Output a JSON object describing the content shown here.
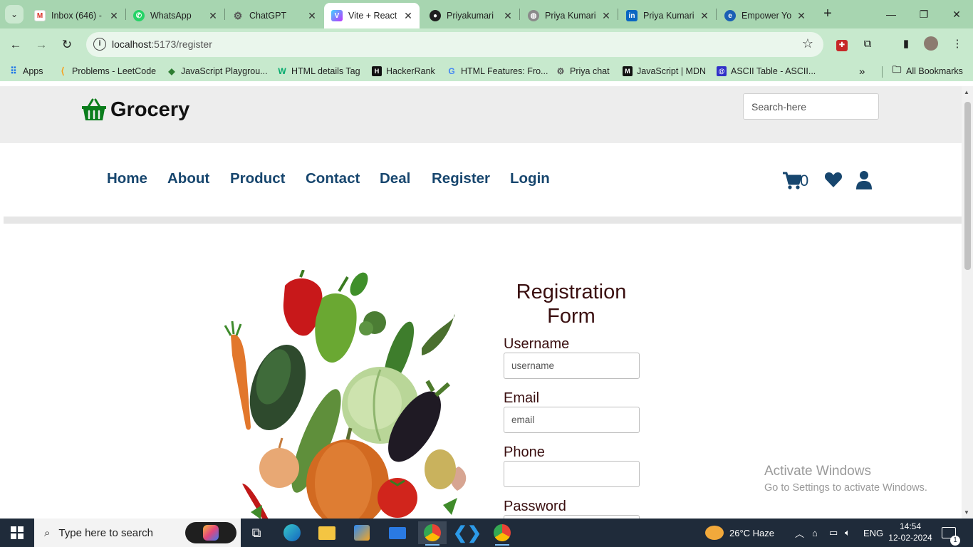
{
  "browser": {
    "tabs": [
      {
        "title": "Inbox (646) -",
        "favicon": "gmail-icon",
        "active": false
      },
      {
        "title": "WhatsApp",
        "favicon": "whatsapp-icon",
        "active": false
      },
      {
        "title": "ChatGPT",
        "favicon": "chatgpt-icon",
        "active": false
      },
      {
        "title": "Vite + React",
        "favicon": "vite-icon",
        "active": true
      },
      {
        "title": "Priyakumari",
        "favicon": "github-icon",
        "active": false
      },
      {
        "title": "Priya Kumari",
        "favicon": "globe-icon",
        "active": false
      },
      {
        "title": "Priya Kumari",
        "favicon": "linkedin-icon",
        "active": false
      },
      {
        "title": "Empower Yo",
        "favicon": "edge-icon",
        "active": false
      }
    ],
    "url_host": "localhost",
    "url_path": ":5173/register",
    "bookmarks": [
      {
        "label": "Apps",
        "icon": "apps-grid-icon"
      },
      {
        "label": "Problems - LeetCode",
        "icon": "leetcode-icon"
      },
      {
        "label": "JavaScript Playgrou...",
        "icon": "playground-icon"
      },
      {
        "label": "HTML details Tag",
        "icon": "w3schools-icon"
      },
      {
        "label": "HackerRank",
        "icon": "hackerrank-icon"
      },
      {
        "label": "HTML Features: Fro...",
        "icon": "google-icon"
      },
      {
        "label": "Priya chat",
        "icon": "chatgpt-icon"
      },
      {
        "label": "JavaScript | MDN",
        "icon": "mdn-icon"
      },
      {
        "label": "ASCII Table - ASCII...",
        "icon": "ascii-icon"
      }
    ],
    "more_bookmarks": "»",
    "all_bookmarks": "All Bookmarks"
  },
  "site": {
    "logo_text": "Grocery",
    "search_placeholder": "Search-here",
    "nav": [
      "Home",
      "About",
      "Product",
      "Contact",
      "Deal",
      "Register",
      "Login"
    ],
    "cart_count": "0",
    "form": {
      "title_line1": "Registration",
      "title_line2": "Form",
      "username_label": "Username",
      "username_placeholder": "username",
      "email_label": "Email",
      "email_placeholder": "email",
      "phone_label": "Phone",
      "password_label": "Password"
    }
  },
  "watermark": {
    "line1": "Activate Windows",
    "line2": "Go to Settings to activate Windows."
  },
  "taskbar": {
    "search_placeholder": "Type here to search",
    "weather": "26°C  Haze",
    "language": "ENG",
    "time": "14:54",
    "date": "12-02-2024",
    "notifications": "1"
  },
  "colors": {
    "chrome_tabstrip": "#a7d5b0",
    "chrome_toolbar": "#c7e9cd",
    "nav_link": "#17466e",
    "form_text": "#3a0f10",
    "logo_basket": "#0a7d1c"
  }
}
